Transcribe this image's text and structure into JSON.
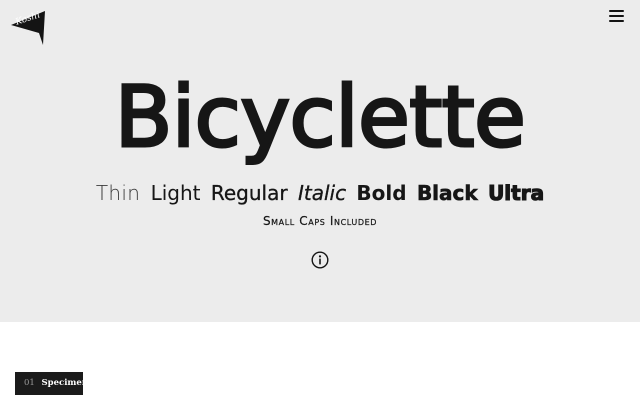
{
  "logo": {
    "text": "Koshi",
    "icon": "pennant-flag-icon"
  },
  "header": {
    "menu_icon": "hamburger-menu-icon"
  },
  "hero": {
    "title": "Bicyclette",
    "weights": [
      "Thin",
      "Light",
      "Regular",
      "Italic",
      "Bold",
      "Black",
      "Ultra"
    ],
    "subtitle": "Small Caps Included",
    "info_icon": "info-circle-icon"
  },
  "section": {
    "number": "01",
    "label": "Specimen"
  },
  "colors": {
    "hero_background": "#ececec",
    "page_background": "#ffffff",
    "ink": "#161616",
    "label_background": "#1b1b1b"
  }
}
